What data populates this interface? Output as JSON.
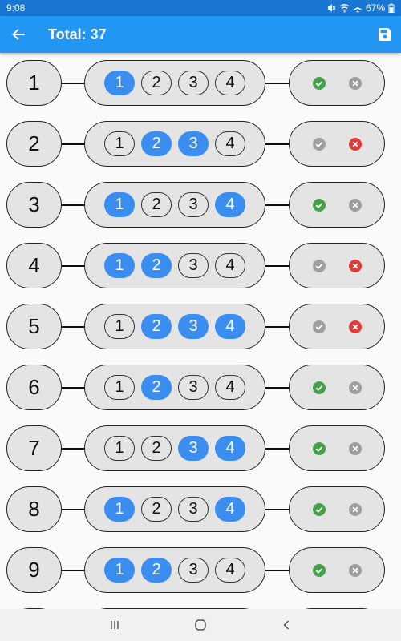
{
  "status_bar": {
    "time": "9:08",
    "battery": "67%",
    "icons": [
      "mute-icon",
      "wifi-icon",
      "airplane-icon",
      "battery-icon"
    ]
  },
  "app_bar": {
    "title": "Total: 37",
    "back_icon": "arrow-left-icon",
    "save_icon": "save-icon"
  },
  "colors": {
    "status_bar": "#1976d2",
    "app_bar": "#2196f3",
    "selected": "#3b8ef0",
    "check_active": "#43a047",
    "cross_active": "#e53935",
    "inactive": "#9e9e9e"
  },
  "rows": [
    {
      "number": "1",
      "options": [
        "1",
        "2",
        "3",
        "4"
      ],
      "selected": [
        true,
        false,
        false,
        false
      ],
      "result": "check"
    },
    {
      "number": "2",
      "options": [
        "1",
        "2",
        "3",
        "4"
      ],
      "selected": [
        false,
        true,
        true,
        false
      ],
      "result": "cross"
    },
    {
      "number": "3",
      "options": [
        "1",
        "2",
        "3",
        "4"
      ],
      "selected": [
        true,
        false,
        false,
        true
      ],
      "result": "check"
    },
    {
      "number": "4",
      "options": [
        "1",
        "2",
        "3",
        "4"
      ],
      "selected": [
        true,
        true,
        false,
        false
      ],
      "result": "cross"
    },
    {
      "number": "5",
      "options": [
        "1",
        "2",
        "3",
        "4"
      ],
      "selected": [
        false,
        true,
        true,
        true
      ],
      "result": "cross"
    },
    {
      "number": "6",
      "options": [
        "1",
        "2",
        "3",
        "4"
      ],
      "selected": [
        false,
        true,
        false,
        false
      ],
      "result": "check"
    },
    {
      "number": "7",
      "options": [
        "1",
        "2",
        "3",
        "4"
      ],
      "selected": [
        false,
        false,
        true,
        true
      ],
      "result": "check"
    },
    {
      "number": "8",
      "options": [
        "1",
        "2",
        "3",
        "4"
      ],
      "selected": [
        true,
        false,
        false,
        true
      ],
      "result": "check"
    },
    {
      "number": "9",
      "options": [
        "1",
        "2",
        "3",
        "4"
      ],
      "selected": [
        true,
        true,
        false,
        false
      ],
      "result": "check"
    },
    {
      "number": "",
      "options": [
        "",
        "",
        "",
        ""
      ],
      "selected": [
        false,
        false,
        false,
        false
      ],
      "result": "check"
    }
  ],
  "nav_bar": {
    "icons": [
      "recent-apps-icon",
      "home-icon",
      "back-icon"
    ]
  }
}
